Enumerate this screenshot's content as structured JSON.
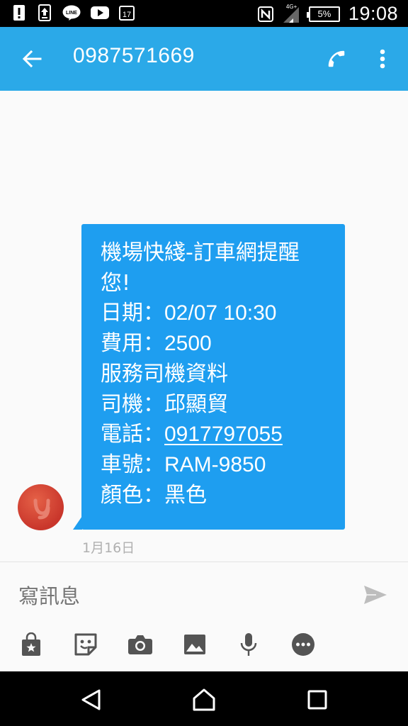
{
  "status_bar": {
    "time": "19:08",
    "battery": "5%",
    "network": "4G+",
    "icons": [
      "alert-icon",
      "upload-icon",
      "line-icon",
      "youtube-icon",
      "calendar-icon",
      "nfc-icon",
      "signal-icon",
      "battery-icon"
    ]
  },
  "app_bar": {
    "title": "0987571669",
    "back_icon": "arrow-left-icon",
    "call_icon": "phone-icon",
    "more_icon": "more-vert-icon"
  },
  "message": {
    "lines": [
      "機場快綫-訂車網提醒",
      "您!",
      "日期：",
      "費用：",
      "服務司機資料",
      "司機：邱顯貿",
      "電話：",
      "車號：",
      "顏色：黑色"
    ],
    "date_value": "02/07 10:30",
    "fee_value": "2500",
    "phone_value": "0917797055",
    "plate_value": "RAM-9850",
    "timestamp": "1月16日"
  },
  "composer": {
    "placeholder": "寫訊息",
    "send_icon": "send-icon",
    "tools": [
      "store-icon",
      "sticker-icon",
      "camera-icon",
      "image-icon",
      "mic-icon",
      "more-horiz-icon"
    ]
  },
  "nav_bar": {
    "buttons": [
      "back-triangle-icon",
      "home-icon",
      "recents-icon"
    ]
  },
  "colors": {
    "app_bar": "#2ba9e8",
    "bubble": "#1e9ef0",
    "avatar": "#d4412f"
  }
}
